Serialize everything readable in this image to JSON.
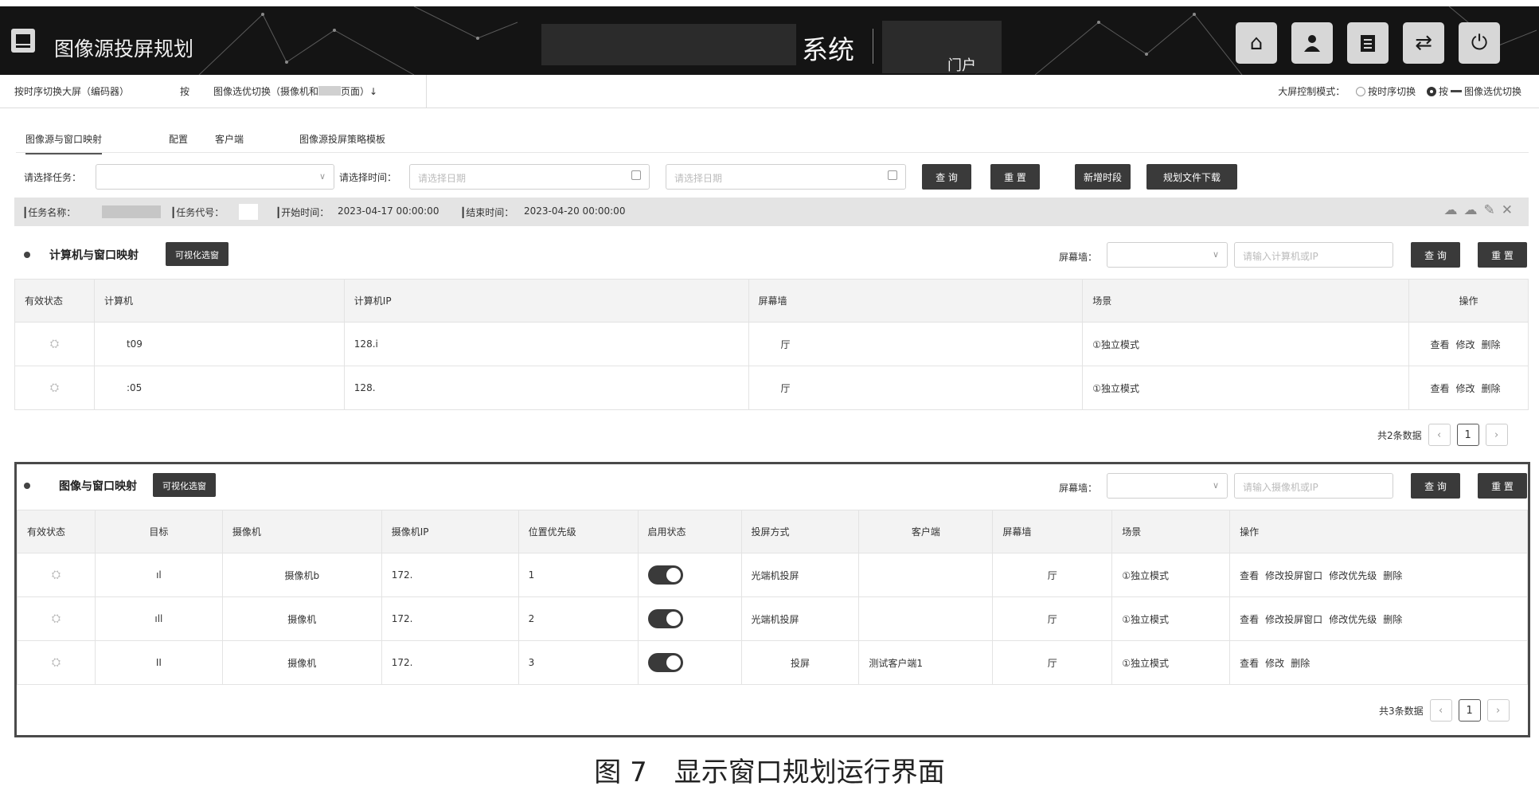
{
  "header": {
    "app_title": "图像源投屏规划",
    "system_title": "系统",
    "portal_label": "门户",
    "icons": [
      "home-icon",
      "user-icon",
      "clipboard-icon",
      "refresh-icon",
      "power-icon"
    ]
  },
  "mode_bar": {
    "tab_encoder": "按时序切换大屏（编码器）",
    "tab_by": "按",
    "tab_image_prefix": "图像选优切换（摄像机和",
    "tab_image_suffix": "页面）↓",
    "mode_label": "大屏控制模式：",
    "option_time": "按时序切换",
    "option_image_prefix": "按",
    "option_image_suffix": "图像选优切换"
  },
  "subtabs": [
    "图像源与窗口映射",
    "配置",
    "客户端",
    "图像源投屏策略模板"
  ],
  "filters": {
    "task_label": "请选择任务：",
    "time_label": "请选择时间：",
    "date_placeholder_1": "请选择日期",
    "date_placeholder_2": "请选择日期",
    "buttons": {
      "query": "查 询",
      "reset": "重 置",
      "add_period": "新增时段",
      "download": "规划文件下载"
    }
  },
  "task_info": {
    "name_label": "┃任务名称：",
    "code_label": "┃任务代号：",
    "start_label": "┃开始时间：",
    "start_value": "2023-04-17 00:00:00",
    "end_label": "┃结束时间：",
    "end_value": "2023-04-20 00:00:00"
  },
  "section1": {
    "title": "计算机与窗口映射",
    "vis_button": "可视化选窗",
    "screen_label": "屏幕墙：",
    "search_placeholder": "请输入计算机或IP",
    "query": "查 询",
    "reset": "重 置",
    "columns": [
      "有效状态",
      "计算机",
      "计算机IP",
      "屏幕墙",
      "场景",
      "操作"
    ],
    "rows": [
      {
        "computer": "t09",
        "ip": "128.i",
        "wall": "厅",
        "scene": "①独立模式",
        "ops": [
          "查看",
          "修改",
          "删除"
        ]
      },
      {
        "computer": ":05",
        "ip": "128.",
        "wall": "厅",
        "scene": "①独立模式",
        "ops": [
          "查看",
          "修改",
          "删除"
        ]
      }
    ],
    "total": "共2条数据",
    "page": "1"
  },
  "section2": {
    "title": "图像与窗口映射",
    "vis_button": "可视化选窗",
    "screen_label": "屏幕墙：",
    "search_placeholder": "请输入摄像机或IP",
    "query": "查 询",
    "reset": "重 置",
    "columns": [
      "有效状态",
      "目标",
      "摄像机",
      "摄像机IP",
      "位置优先级",
      "启用状态",
      "投屏方式",
      "客户端",
      "屏幕墙",
      "场景",
      "操作"
    ],
    "rows": [
      {
        "target": "ıl",
        "camera": "摄像机b",
        "ip": "172.",
        "priority": "1",
        "enabled": true,
        "method": "光端机投屏",
        "client": "",
        "wall": "厅",
        "scene": "①独立模式",
        "ops": [
          "查看",
          "修改投屏窗口",
          "修改优先级",
          "删除"
        ]
      },
      {
        "target": "ıll",
        "camera": "摄像机",
        "ip": "172.",
        "priority": "2",
        "enabled": true,
        "method": "光端机投屏",
        "client": "",
        "wall": "厅",
        "scene": "①独立模式",
        "ops": [
          "查看",
          "修改投屏窗口",
          "修改优先级",
          "删除"
        ]
      },
      {
        "target": "II",
        "camera": "摄像机",
        "ip": "172.",
        "priority": "3",
        "enabled": true,
        "method": "投屏",
        "client": "测试客户端1",
        "wall": "厅",
        "scene": "①独立模式",
        "ops": [
          "查看",
          "修改",
          "删除"
        ]
      }
    ],
    "total": "共3条数据",
    "page": "1"
  },
  "caption": "图 7　显示窗口规划运行界面"
}
